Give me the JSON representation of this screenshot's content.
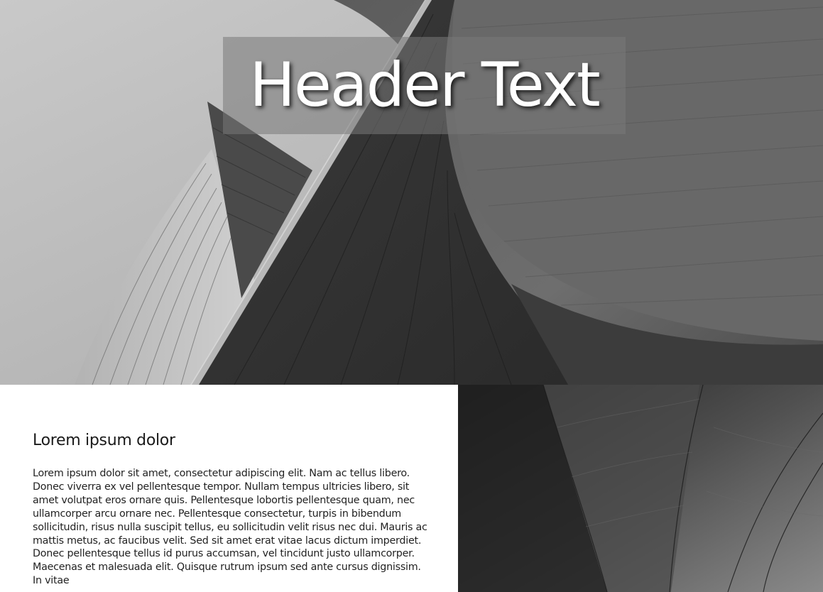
{
  "hero": {
    "title": "Header Text"
  },
  "content": {
    "title": "Lorem ipsum dolor",
    "body": "Lorem ipsum dolor sit amet, consectetur adipiscing elit. Nam ac tellus libero. Donec viverra ex vel pellentesque tempor. Nullam tempus ultricies libero, sit amet volutpat eros ornare quis. Pellentesque lobortis pellentesque quam, nec ullamcorper arcu ornare nec. Pellentesque consectetur, turpis in bibendum sollicitudin, risus nulla suscipit tellus, eu sollicitudin velit risus nec dui. Mauris ac mattis metus, ac faucibus velit. Sed sit amet erat vitae lacus dictum imperdiet. Donec pellentesque tellus id purus accumsan, vel tincidunt justo ullamcorper. Maecenas et malesuada elit. Quisque rutrum ipsum sed ante cursus dignissim. In vitae"
  }
}
